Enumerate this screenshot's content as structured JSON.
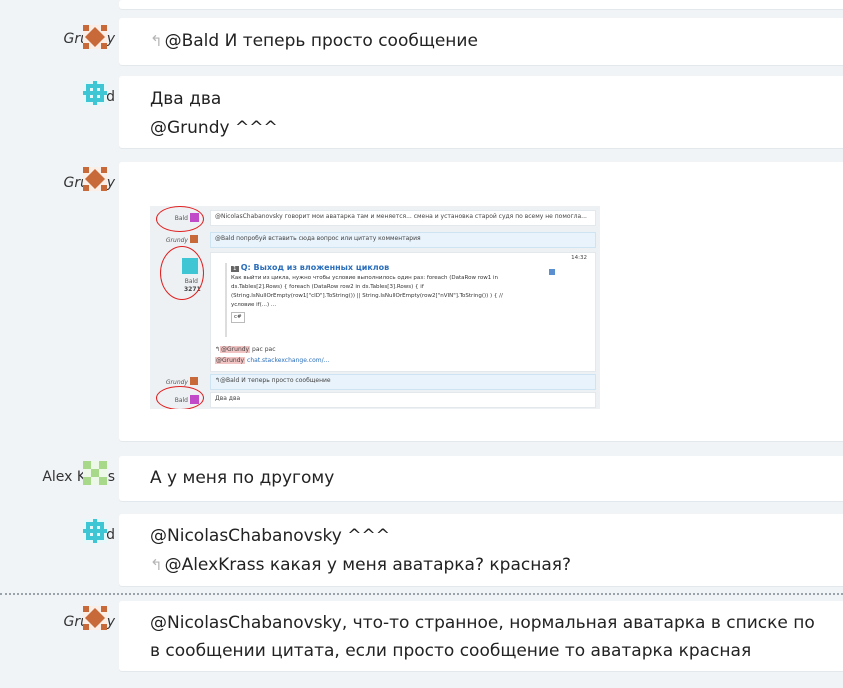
{
  "messages": [
    {
      "user": "Grundy",
      "reply_text": "@Bald И теперь просто сообщение"
    },
    {
      "user": "Bald",
      "lines": [
        "Два два",
        "@Grundy ^^^"
      ]
    },
    {
      "user": "Grundy"
    },
    {
      "user": "Alex Krass",
      "text": "А у меня по другому"
    },
    {
      "user": "Bald",
      "line1": "@NicolasChabanovsky ^^^",
      "reply_text": "@AlexKrass какая у меня аватарка? красная?"
    },
    {
      "user": "Grundy",
      "lines": [
        "@NicolasChabanovsky, что-то странное, нормальная аватарка в списке по",
        "в сообщении цитата, если просто сообщение то аватарка красная"
      ]
    }
  ],
  "embedded_screenshot": {
    "row1_user": "Bald",
    "row1_text": "@NicolasChabanovsky говорит мои аватарка там и меняется... смена и установка старой судя по всему не помогла...",
    "row2_user": "Grundy",
    "row2_text": "@Bald попробуй вставить сюда вопрос или цитату комментария",
    "row3_user": "Bald",
    "row3_rep": "3271",
    "row3_time": "14:32",
    "onebox_score": "1",
    "onebox_title": "Q: Выход из вложенных циклов",
    "onebox_body": [
      "Как выйти из цикла, нужно чтобы условие выполнилось один раз: foreach (DataRow row1 in",
      "ds.Tables[2].Rows) { foreach (DataRow row2 in ds.Tables[3].Rows) { if",
      "(String.IsNullOrEmpty(row1[\"cID\"].ToString()) || String.IsNullOrEmpty(row2[\"nVIN\"].ToString()) ) { //",
      "условие if(...) ..."
    ],
    "onebox_tag": "c#",
    "row3_reply_mention": "@Grundy",
    "row3_reply_text": "рас рас",
    "row3_link_mention": "@Grundy",
    "row3_link": "chat.stackexchange.com/...",
    "row4_user": "Grundy",
    "row4_text": "@Bald И теперь просто сообщение",
    "row5_user": "Bald",
    "row5_text": "Два два"
  },
  "colors": {
    "grundy_avatar": "#c8693a",
    "bald_avatar": "#3fc6d4",
    "alex_avatar": "#a8d98a",
    "link": "#2a6ebb"
  }
}
